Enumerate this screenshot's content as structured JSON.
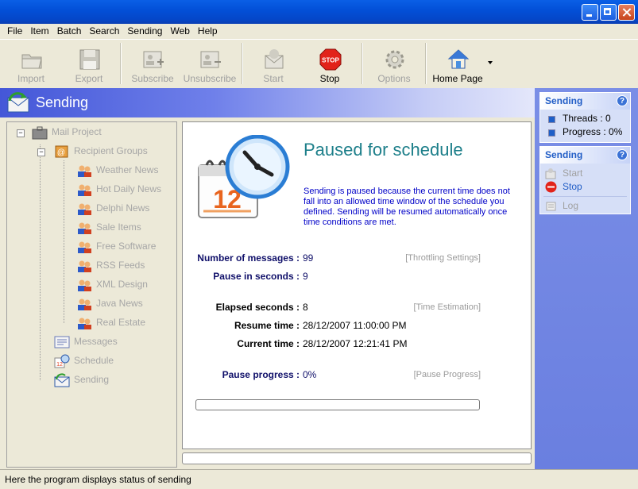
{
  "menu": [
    "File",
    "Item",
    "Batch",
    "Search",
    "Sending",
    "Web",
    "Help"
  ],
  "toolbar": {
    "import": "Import",
    "export": "Export",
    "subscribe": "Subscribe",
    "unsubscribe": "Unsubscribe",
    "start": "Start",
    "stop": "Stop",
    "options": "Options",
    "home_page": "Home Page"
  },
  "header": {
    "title": "Sending"
  },
  "tree": {
    "root": "Mail Project",
    "recipient_groups": "Recipient Groups",
    "groups": [
      "Weather News",
      "Hot Daily News",
      "Delphi News",
      "Sale Items",
      "Free Software",
      "RSS Feeds",
      "XML Design",
      "Java News",
      "Real Estate"
    ],
    "messages": "Messages",
    "schedule": "Schedule",
    "sending": "Sending"
  },
  "main": {
    "title": "Paused for schedule",
    "description": "Sending is paused because the current time does not fall into an allowed time window of the schedule you defined. Sending will be resumed automatically once time conditions are met.",
    "calendar_day": "12",
    "rows": {
      "num_messages_label": "Number of messages :",
      "num_messages_value": "99",
      "throttling_link": "[Throttling Settings]",
      "pause_seconds_label": "Pause in seconds :",
      "pause_seconds_value": "9",
      "elapsed_label": "Elapsed seconds :",
      "elapsed_value": "8",
      "time_estimation_link": "[Time Estimation]",
      "resume_label": "Resume time :",
      "resume_value": "28/12/2007 11:00:00 PM",
      "current_label": "Current time :",
      "current_value": "28/12/2007 12:21:41 PM",
      "pause_progress_label": "Pause progress :",
      "pause_progress_value": "0%",
      "pause_progress_link": "[Pause Progress]"
    },
    "progress_fraction": 0
  },
  "right": {
    "box1": {
      "title": "Sending",
      "threads": "Threads : 0",
      "progress": "Progress : 0%"
    },
    "box2": {
      "title": "Sending",
      "start": "Start",
      "stop": "Stop",
      "log": "Log"
    }
  },
  "status": "Here the program displays status of sending",
  "stop_icon_text": "STOP"
}
